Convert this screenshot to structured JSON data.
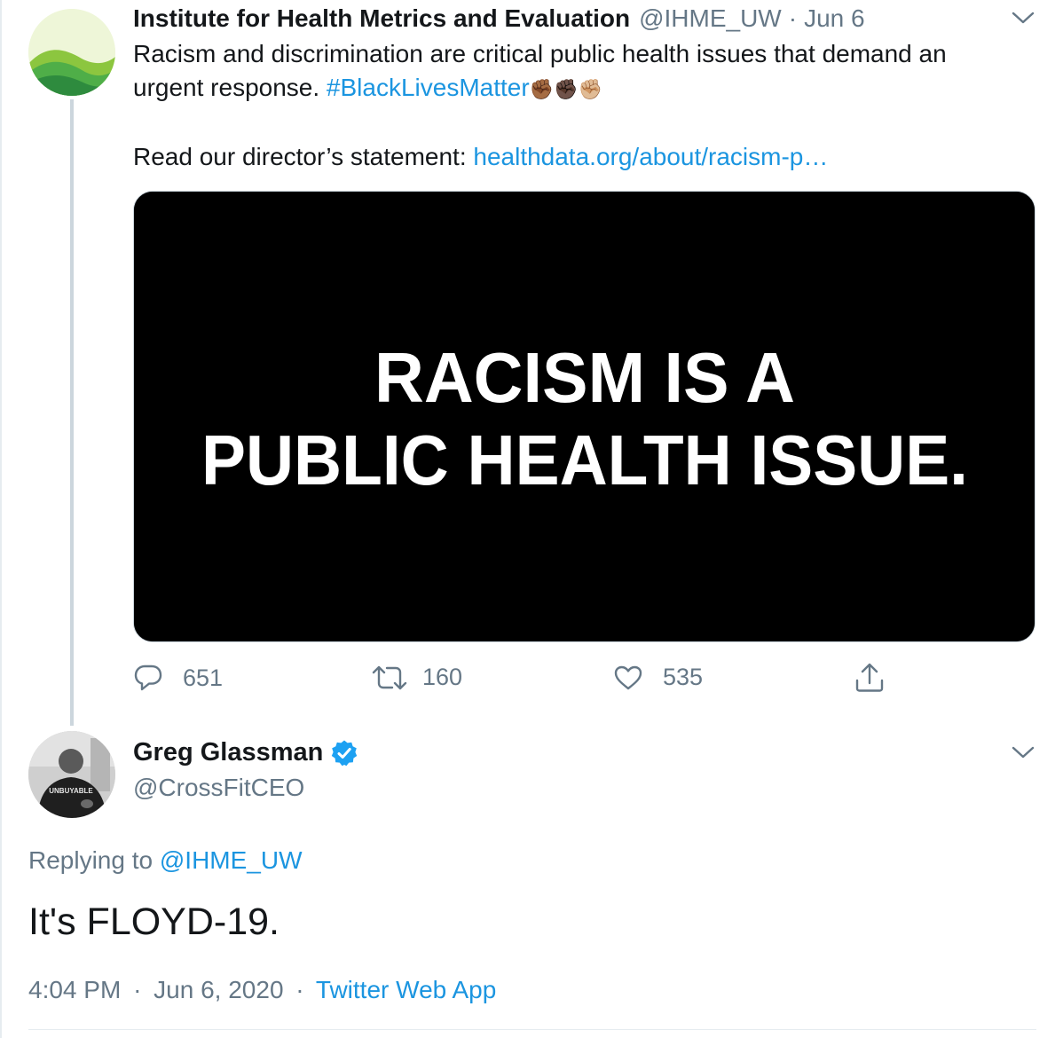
{
  "tweet": {
    "author_name": "Institute for Health Metrics and Evaluation",
    "author_handle": "@IHME_UW",
    "separator": "·",
    "date": "Jun 6",
    "text_line1": "Racism and discrimination are critical public health issues that demand an",
    "text_line2_prefix": "urgent response. ",
    "hashtag": "#BlackLivesMatter",
    "emoji": "✊🏾✊🏿✊🏼",
    "text_line3_prefix": "Read our director’s statement: ",
    "link": "healthdata.org/about/racism-p…",
    "media_line1": "RACISM IS A",
    "media_line2": "PUBLIC HEALTH ISSUE.",
    "reply_count": "651",
    "retweet_count": "160",
    "like_count": "535"
  },
  "reply": {
    "author_name": "Greg Glassman",
    "author_handle": "@CrossFitCEO",
    "avatar_shirt_text": "UNBUYABLE",
    "replying_prefix": "Replying to ",
    "replying_handle": "@IHME_UW",
    "text": "It's FLOYD-19.",
    "time": "4:04 PM",
    "separator": "·",
    "date": "Jun 6, 2020",
    "source": "Twitter Web App"
  },
  "colors": {
    "link": "#1b95e0",
    "secondary_text": "#657786",
    "primary_text": "#14171a",
    "verified": "#1da1f2"
  }
}
